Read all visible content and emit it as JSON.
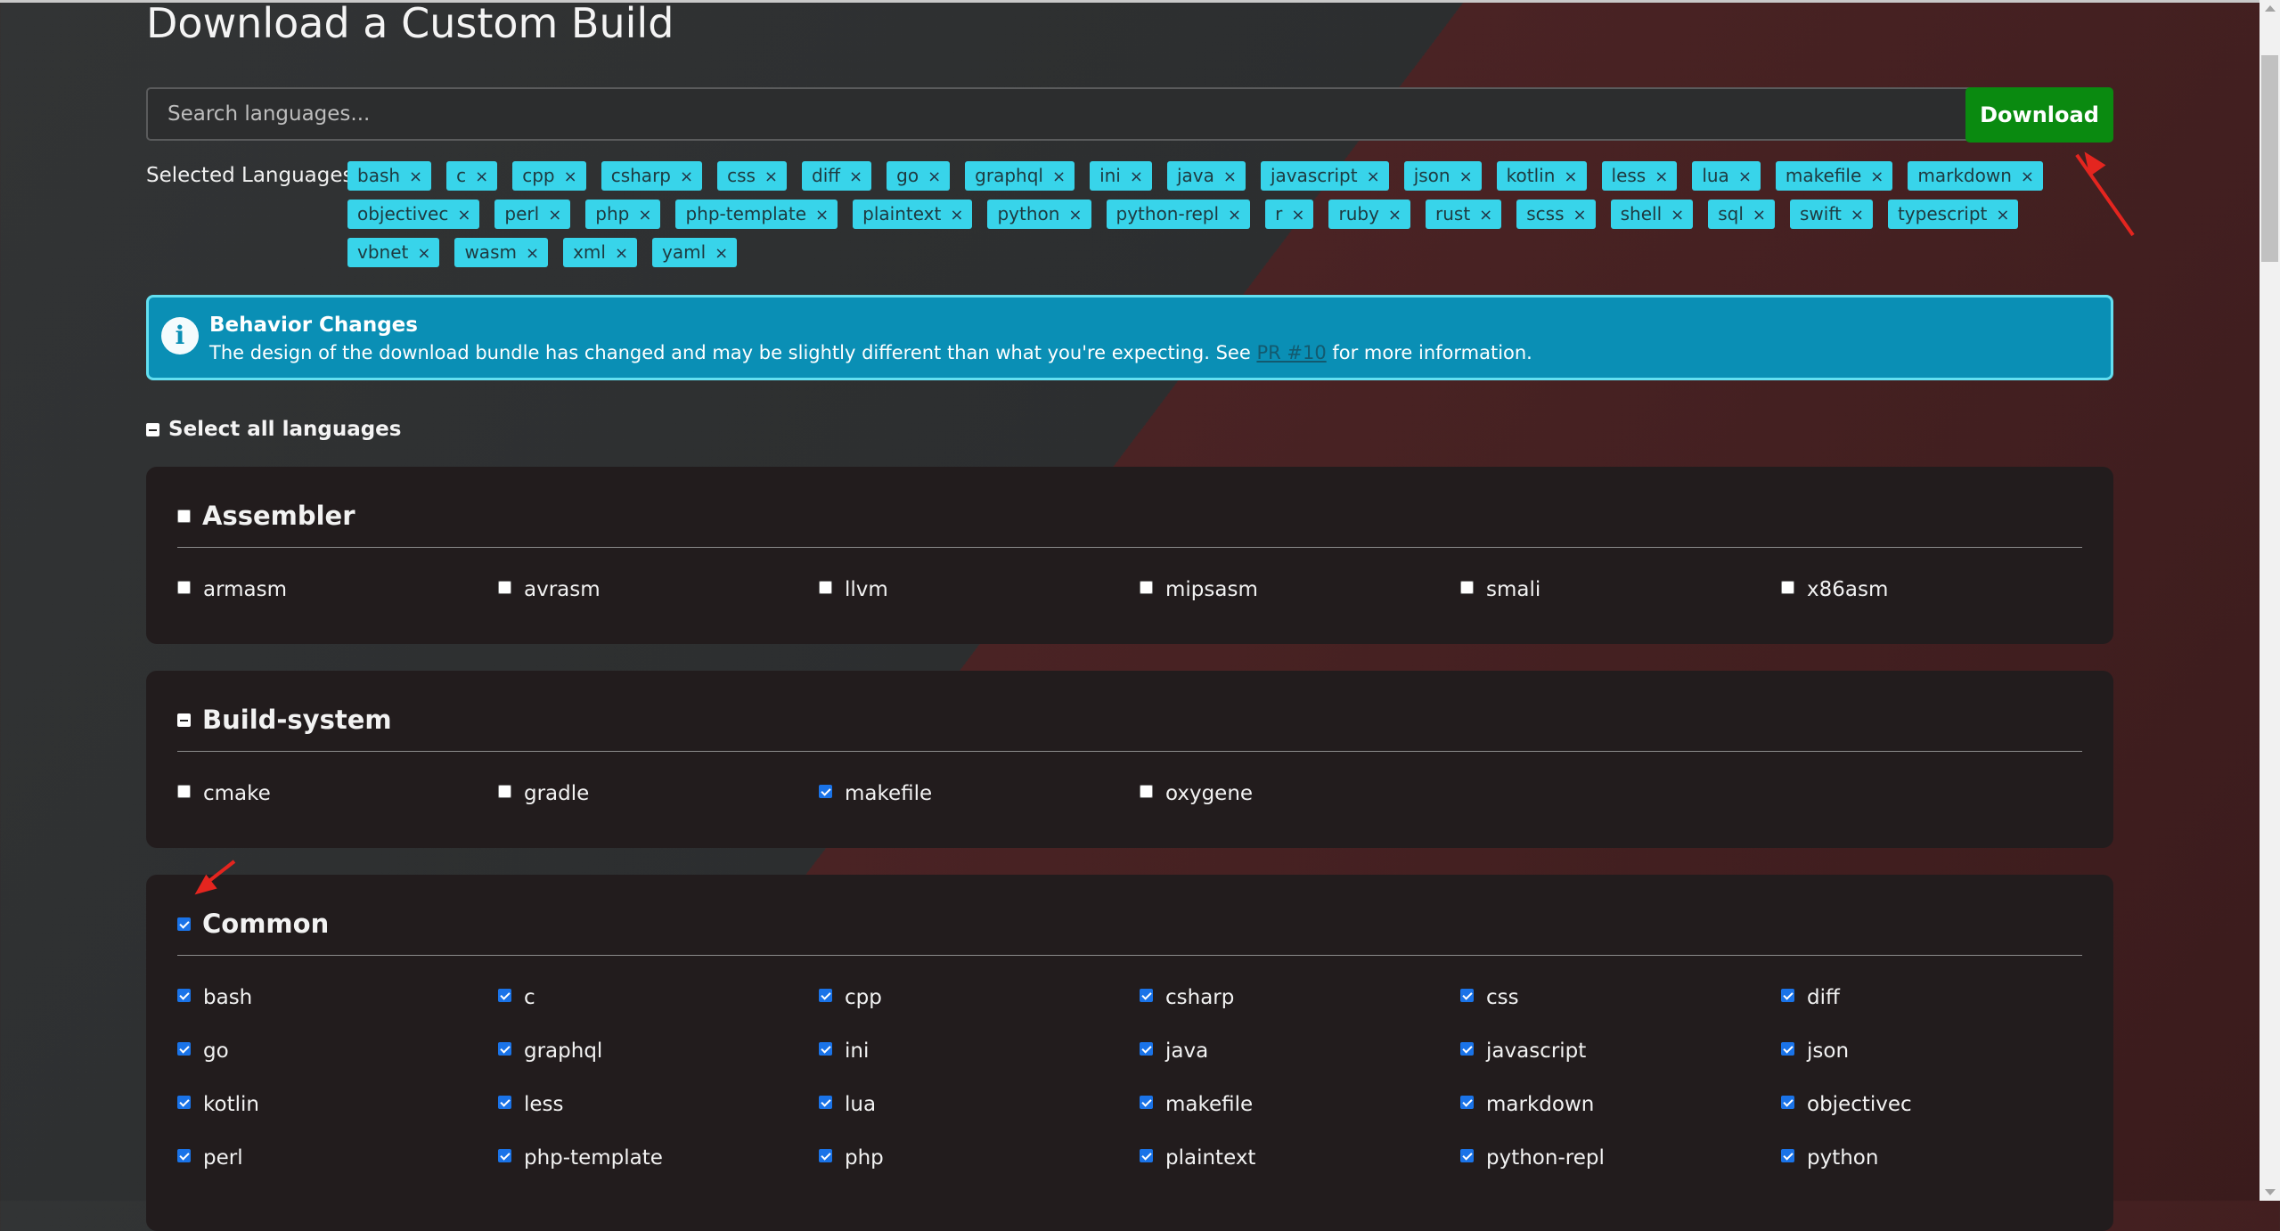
{
  "page": {
    "title": "Download a Custom Build",
    "search_placeholder": "Search languages...",
    "download_label": "Download",
    "selected_label": "Selected Languages:"
  },
  "selected_languages": [
    "bash",
    "c",
    "cpp",
    "csharp",
    "css",
    "diff",
    "go",
    "graphql",
    "ini",
    "java",
    "javascript",
    "json",
    "kotlin",
    "less",
    "lua",
    "makefile",
    "markdown",
    "objectivec",
    "perl",
    "php",
    "php-template",
    "plaintext",
    "python",
    "python-repl",
    "r",
    "ruby",
    "rust",
    "scss",
    "shell",
    "sql",
    "swift",
    "typescript",
    "vbnet",
    "wasm",
    "xml",
    "yaml"
  ],
  "notice": {
    "title": "Behavior Changes",
    "text_before": "The design of the download bundle has changed and may be slightly different than what you're expecting. See ",
    "link": "PR #10",
    "text_after": " for more information."
  },
  "select_all": {
    "label": "Select all languages",
    "state": "mixed"
  },
  "categories": [
    {
      "name": "Assembler",
      "state": "unchecked",
      "items": [
        {
          "label": "armasm",
          "checked": false
        },
        {
          "label": "avrasm",
          "checked": false
        },
        {
          "label": "llvm",
          "checked": false
        },
        {
          "label": "mipsasm",
          "checked": false
        },
        {
          "label": "smali",
          "checked": false
        },
        {
          "label": "x86asm",
          "checked": false
        }
      ]
    },
    {
      "name": "Build-system",
      "state": "mixed",
      "items": [
        {
          "label": "cmake",
          "checked": false
        },
        {
          "label": "gradle",
          "checked": false
        },
        {
          "label": "makefile",
          "checked": true
        },
        {
          "label": "oxygene",
          "checked": false
        }
      ]
    },
    {
      "name": "Common",
      "state": "checked",
      "items": [
        {
          "label": "bash",
          "checked": true
        },
        {
          "label": "c",
          "checked": true
        },
        {
          "label": "cpp",
          "checked": true
        },
        {
          "label": "csharp",
          "checked": true
        },
        {
          "label": "css",
          "checked": true
        },
        {
          "label": "diff",
          "checked": true
        },
        {
          "label": "go",
          "checked": true
        },
        {
          "label": "graphql",
          "checked": true
        },
        {
          "label": "ini",
          "checked": true
        },
        {
          "label": "java",
          "checked": true
        },
        {
          "label": "javascript",
          "checked": true
        },
        {
          "label": "json",
          "checked": true
        },
        {
          "label": "kotlin",
          "checked": true
        },
        {
          "label": "less",
          "checked": true
        },
        {
          "label": "lua",
          "checked": true
        },
        {
          "label": "makefile",
          "checked": true
        },
        {
          "label": "markdown",
          "checked": true
        },
        {
          "label": "objectivec",
          "checked": true
        },
        {
          "label": "perl",
          "checked": true
        },
        {
          "label": "php-template",
          "checked": true
        },
        {
          "label": "php",
          "checked": true
        },
        {
          "label": "plaintext",
          "checked": true
        },
        {
          "label": "python-repl",
          "checked": true
        },
        {
          "label": "python",
          "checked": true
        }
      ]
    }
  ],
  "colors": {
    "accent_button": "#0a8a10",
    "chip": "#38d4ea",
    "notice": "#0a8fb5",
    "annotation_arrow": "#e4251f"
  }
}
